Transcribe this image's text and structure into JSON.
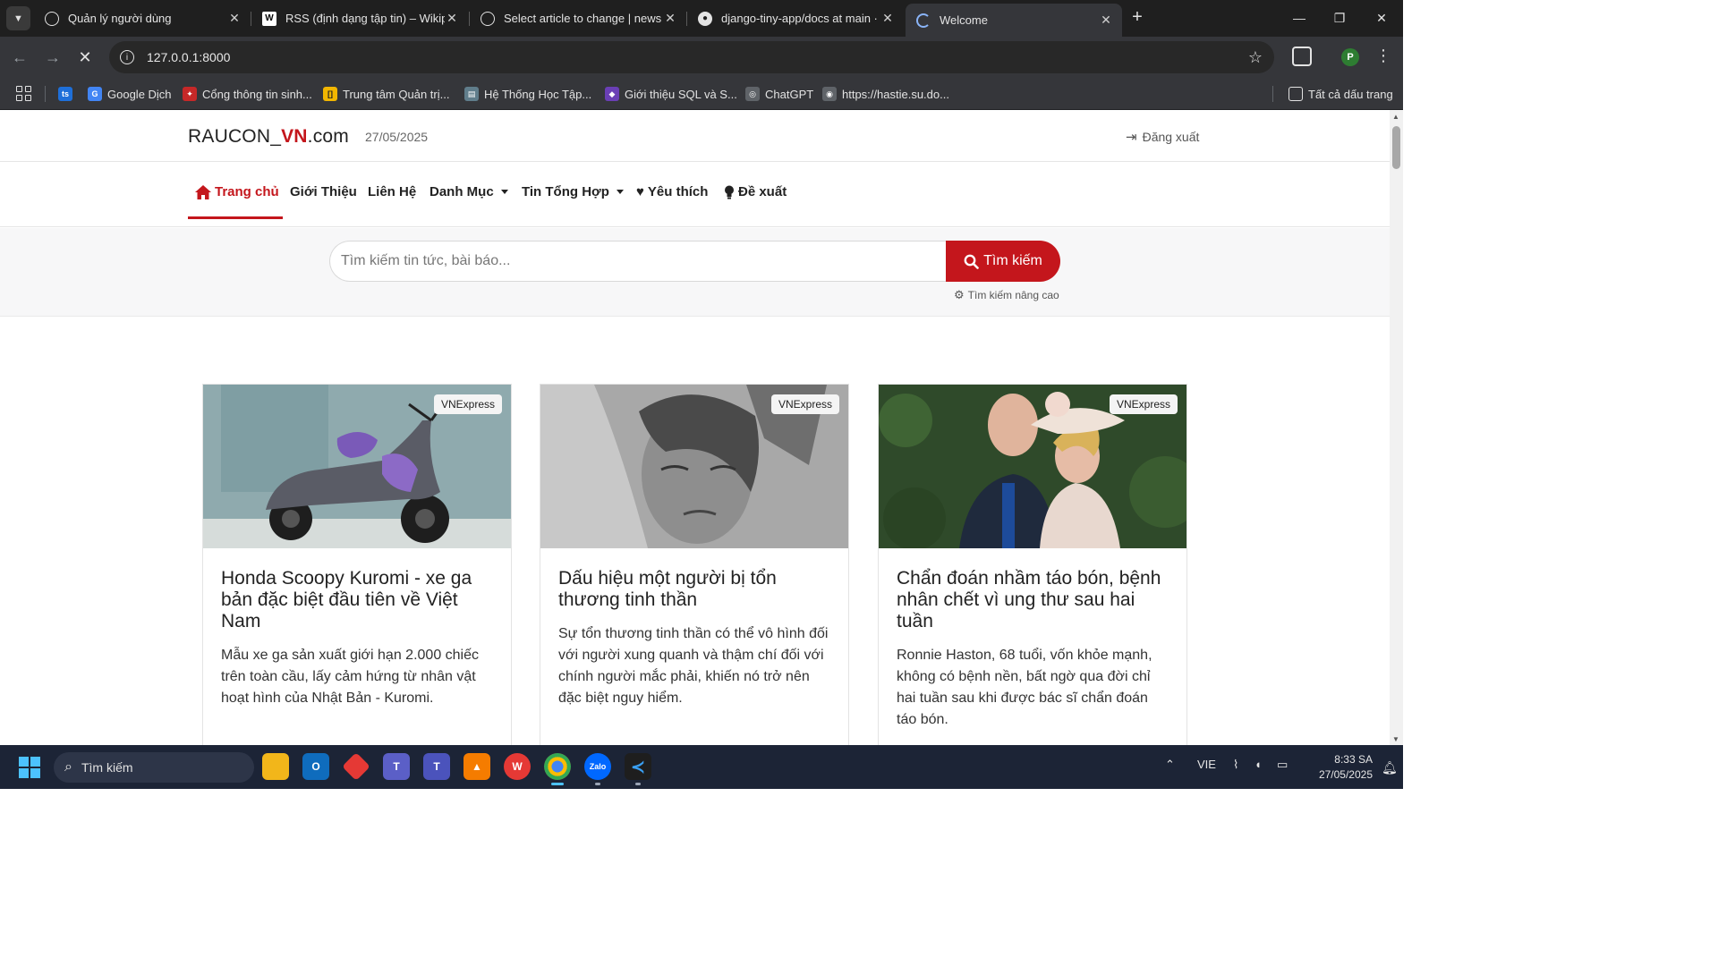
{
  "browser": {
    "tabs": [
      {
        "title": "Quản lý người dùng",
        "icon": "globe-icon",
        "active": false
      },
      {
        "title": "RSS (định dạng tập tin) – Wikip",
        "icon": "wikipedia-icon",
        "active": false
      },
      {
        "title": "Select article to change | news a",
        "icon": "globe-icon",
        "active": false
      },
      {
        "title": "django-tiny-app/docs at main ·",
        "icon": "github-icon",
        "active": false
      },
      {
        "title": "Welcome",
        "icon": "loading-globe-icon",
        "active": true
      }
    ],
    "new_tab": "+",
    "window_controls": {
      "minimize": "—",
      "restore": "❐",
      "close": "✕"
    },
    "url": "127.0.0.1:8000",
    "profile_initial": "P",
    "bookmarks": [
      {
        "label": "",
        "icon": "ts-icon",
        "color": "#1e6fd9",
        "text": "ts"
      },
      {
        "label": "Google Dịch",
        "icon": "google-translate-icon",
        "color": "#4285f4",
        "text": "G"
      },
      {
        "label": "Cổng thông tin sinh...",
        "icon": "portal-icon",
        "color": "#c62828",
        "text": "✦"
      },
      {
        "label": "Trung tâm Quản trị...",
        "icon": "admin-icon",
        "color": "#f2b600",
        "text": "[]"
      },
      {
        "label": "Hệ Thống Học Tập...",
        "icon": "learning-icon",
        "color": "#607d8b",
        "text": "▤"
      },
      {
        "label": "Giới thiệu SQL và S...",
        "icon": "sql-icon",
        "color": "#6a3fb5",
        "text": "◆"
      },
      {
        "label": "ChatGPT",
        "icon": "chatgpt-icon",
        "color": "#5f6368",
        "text": "◎"
      },
      {
        "label": "https://hastie.su.do...",
        "icon": "globe-icon",
        "color": "#5f6368",
        "text": "◉"
      }
    ],
    "all_bookmarks": "Tất cả dấu trang"
  },
  "site": {
    "logo_prefix": "RAUCON_",
    "logo_accent": "VN",
    "logo_suffix": ".com",
    "date": "27/05/2025",
    "logout": "Đăng xuất",
    "accent_color": "#c4161c",
    "nav": [
      {
        "label": "Trang chủ",
        "icon": "home-icon",
        "active": true
      },
      {
        "label": "Giới Thiệu"
      },
      {
        "label": "Liên Hệ"
      },
      {
        "label": "Danh Mục",
        "dropdown": true
      },
      {
        "label": "Tin Tổng Hợp",
        "dropdown": true
      },
      {
        "label": "Yêu thích",
        "icon": "heart-icon"
      },
      {
        "label": "Đề xuất",
        "icon": "lightbulb-icon"
      }
    ],
    "search": {
      "placeholder": "Tìm kiếm tin tức, bài báo...",
      "button": "Tìm kiếm",
      "advanced": "Tìm kiếm nâng cao"
    },
    "articles": [
      {
        "source": "VNExpress",
        "title": "Honda Scoopy Kuromi - xe ga bản đặc biệt đầu tiên về Việt Nam",
        "description": "Mẫu xe ga sản xuất giới hạn 2.000 chiếc trên toàn cầu, lấy cảm hứng từ nhân vật hoạt hình của Nhật Bản - Kuromi."
      },
      {
        "source": "VNExpress",
        "title": "Dấu hiệu một người bị tổn thương tinh thần",
        "description": "Sự tổn thương tinh thần có thể vô hình đối với người xung quanh và thậm chí đối với chính người mắc phải, khiến nó trở nên đặc biệt nguy hiểm."
      },
      {
        "source": "VNExpress",
        "title": "Chẩn đoán nhầm táo bón, bệnh nhân chết vì ung thư sau hai tuần",
        "description": "Ronnie Haston, 68 tuổi, vốn khỏe mạnh, không có bệnh nền, bất ngờ qua đời chỉ hai tuần sau khi được bác sĩ chẩn đoán táo bón."
      }
    ]
  },
  "taskbar": {
    "search": "Tìm kiếm",
    "language": "VIE",
    "time": "8:33 SA",
    "date": "27/05/2025"
  }
}
